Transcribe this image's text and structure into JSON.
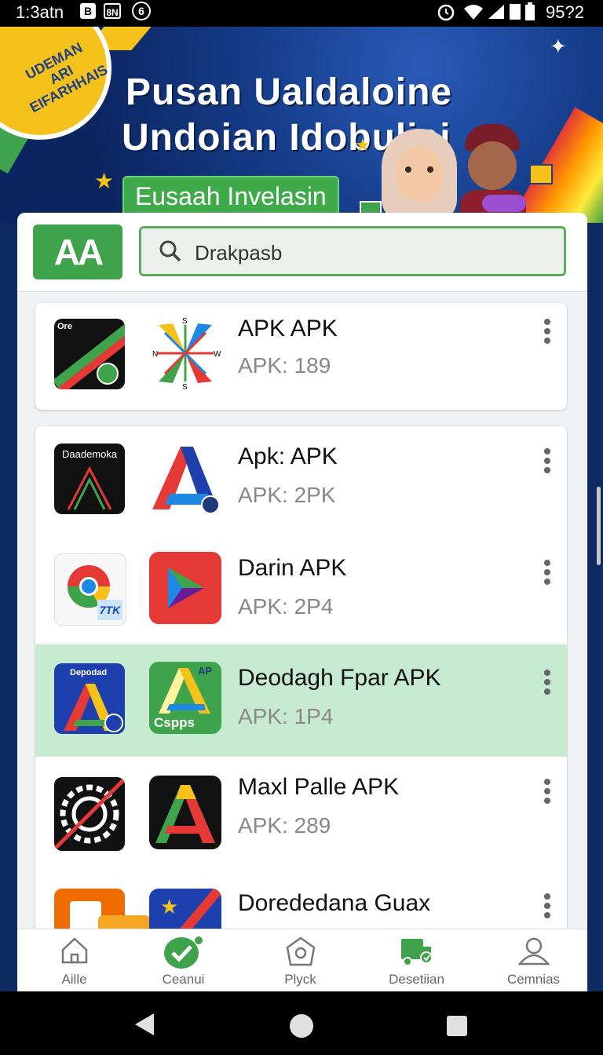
{
  "status_bar": {
    "time": "1:3atn",
    "icons_left": [
      "B",
      "8N",
      "6"
    ],
    "battery": "95?2"
  },
  "banner": {
    "badge": "UDEMAN ARI EIFARHHAIS",
    "title_line1": "Pusan Ualdaloine",
    "title_line2": "Undoian Idobuliai",
    "pill": "Eusaah Invelasin"
  },
  "search_row": {
    "logo_text": "AA",
    "search_text": "Drakpasb"
  },
  "apps": [
    {
      "title": "APK APK",
      "sub": "APK: 189",
      "icon1_text": "Ore",
      "highlight": false
    },
    {
      "title": "Apk: APK",
      "sub": "APK: 2PK",
      "icon1_text": "Daademoka",
      "highlight": false
    },
    {
      "title": "Darin APK",
      "sub": "APK: 2P4",
      "icon1_text": "7TK",
      "highlight": false
    },
    {
      "title": "Deodagh Fpar APK",
      "sub": "APK: 1P4",
      "icon1_text": "Depodad",
      "icon2_text": "Cspps",
      "icon2_corner": "AP",
      "highlight": true
    },
    {
      "title": "Maxl Palle APK",
      "sub": "APK: 289",
      "highlight": false
    },
    {
      "title": "Dorededana Guax",
      "sub": "",
      "highlight": false
    }
  ],
  "compass_letters": {
    "n": "N",
    "s": "S",
    "e": "W",
    "w": "W"
  },
  "bottom_nav": [
    {
      "label": "Aille",
      "icon": "home-icon"
    },
    {
      "label": "Ceanui",
      "icon": "check-icon"
    },
    {
      "label": "Plyck",
      "icon": "pentagon-icon"
    },
    {
      "label": "Desetiian",
      "icon": "truck-icon"
    },
    {
      "label": "Cemnias",
      "icon": "person-icon"
    }
  ],
  "colors": {
    "accent_green": "#3ea34a",
    "highlight_row": "#c7ebd1",
    "banner_blue": "#163e8c",
    "badge_yellow": "#f5c21b"
  }
}
